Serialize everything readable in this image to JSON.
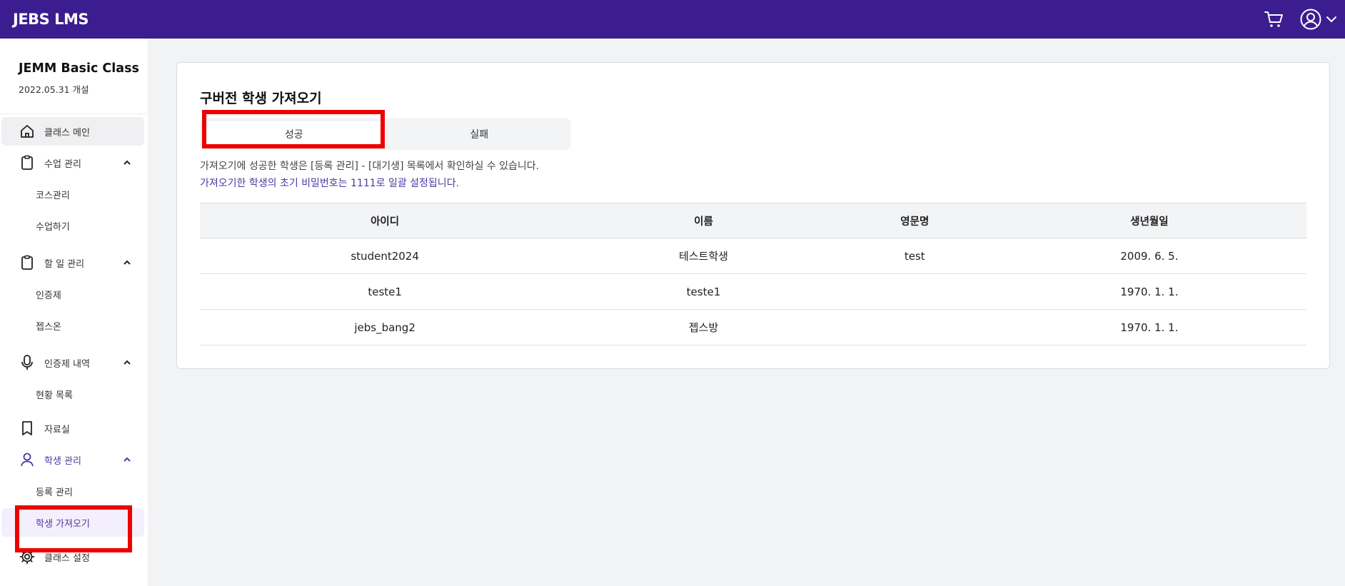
{
  "header": {
    "brand": "JEBS LMS",
    "cart_icon": "cart-icon",
    "profile_icon": "user-circle-icon"
  },
  "sidebar": {
    "class_name": "JEMM Basic Class",
    "class_date": "2022.05.31 개설",
    "items": [
      {
        "label": "클래스 메인",
        "icon": "home-icon"
      },
      {
        "label": "수업 관리",
        "icon": "clipboard-icon"
      },
      {
        "label": "코스관리"
      },
      {
        "label": "수업하기"
      },
      {
        "label": "할 일 관리",
        "icon": "clipboard-icon"
      },
      {
        "label": "인증제"
      },
      {
        "label": "젭스온"
      },
      {
        "label": "인증제 내역",
        "icon": "microphone-icon"
      },
      {
        "label": "현황 목록"
      },
      {
        "label": "자료실",
        "icon": "bookmark-icon"
      },
      {
        "label": "학생 관리",
        "icon": "user-icon"
      },
      {
        "label": "등록 관리"
      },
      {
        "label": "학생 가져오기"
      },
      {
        "label": "클래스 설정",
        "icon": "gear-icon"
      }
    ]
  },
  "main": {
    "title": "구버전 학생 가져오기",
    "tabs": [
      "성공",
      "실패"
    ],
    "description": "가져오기에 성공한 학생은 [등록 관리] - [대기생] 목록에서 확인하실 수 있습니다.",
    "note": "가져오기한 학생의 초기 비밀번호는 1111로 일괄 설정됩니다.",
    "table": {
      "headers": [
        "아이디",
        "이름",
        "영문명",
        "생년월일"
      ],
      "rows": [
        [
          "student2024",
          "테스트학생",
          "test",
          "2009. 6. 5."
        ],
        [
          "teste1",
          "teste1",
          "",
          "1970. 1. 1."
        ],
        [
          "jebs_bang2",
          "젭스방",
          "",
          "1970. 1. 1."
        ]
      ]
    }
  },
  "colors": {
    "header_bg": "#3b1d8f",
    "accent": "#4b3aa0",
    "highlight_box": "#ee0000"
  }
}
